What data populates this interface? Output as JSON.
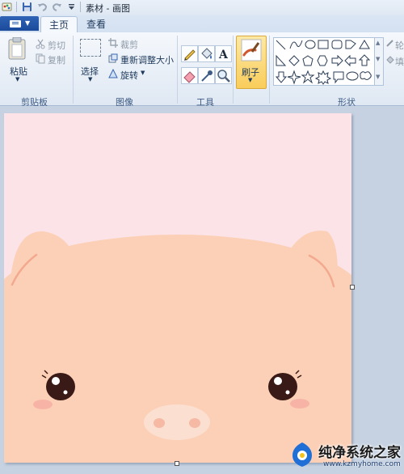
{
  "window": {
    "title": "素材 - 画图"
  },
  "tabs": [
    {
      "label": "主页"
    },
    {
      "label": "查看"
    }
  ],
  "clipboard": {
    "paste": "粘贴",
    "cut": "剪切",
    "copy": "复制",
    "group": "剪贴板"
  },
  "image": {
    "select": "选择",
    "crop": "裁剪",
    "resize": "重新调整大小",
    "rotate": "旋转",
    "group": "图像"
  },
  "tools": {
    "group": "工具"
  },
  "brushes": {
    "label": "刷子"
  },
  "shapes": {
    "group": "形状",
    "right_outline": "轮",
    "right_fill": "填"
  },
  "watermark": {
    "site_name": "纯净系统之家",
    "site_url": "www.kzmyhome.com"
  },
  "colors": {
    "accent": "#2f63b5",
    "canvas_bg": "#fbe3e8",
    "pig_skin": "#fcd0b6",
    "pig_ear_inner": "#f3a98f",
    "cheek": "#f7a9a1"
  }
}
